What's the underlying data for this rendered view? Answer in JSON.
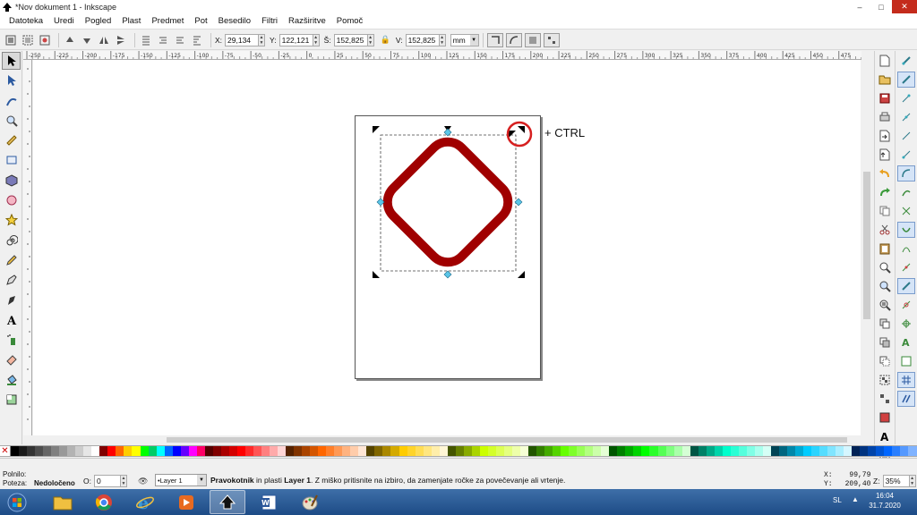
{
  "window": {
    "title": "*Nov dokument 1 - Inkscape",
    "minimize": "–",
    "maximize": "□",
    "close": "✕"
  },
  "menu": [
    "Datoteka",
    "Uredi",
    "Pogled",
    "Plast",
    "Predmet",
    "Pot",
    "Besedilo",
    "Filtri",
    "Razširitve",
    "Pomoč"
  ],
  "toolbar": {
    "x_label": "X:",
    "x_value": "29,134",
    "y_label": "Y:",
    "y_value": "122,121",
    "w_label": "Š:",
    "w_value": "152,825",
    "h_label": "V:",
    "h_value": "152,825",
    "unit": "mm"
  },
  "ruler": {
    "top_ticks": [
      "-250",
      "-225",
      "-200",
      "-175",
      "-150",
      "-125",
      "-100",
      "-75",
      "-50",
      "-25",
      "0",
      "25",
      "50",
      "75",
      "100",
      "125",
      "150",
      "175",
      "200",
      "225",
      "250",
      "275",
      "300",
      "325",
      "350",
      "375",
      "400",
      "425",
      "450",
      "475"
    ]
  },
  "canvas": {
    "annotation": "+ CTRL",
    "shape_color": "#a00000",
    "highlight_circle_color": "#d62020"
  },
  "palette": [
    "#000000",
    "#1a1a1a",
    "#333333",
    "#4d4d4d",
    "#666666",
    "#808080",
    "#999999",
    "#b3b3b3",
    "#cccccc",
    "#e6e6e6",
    "#ffffff",
    "#800000",
    "#ff0000",
    "#ff6600",
    "#ffcc00",
    "#ffff00",
    "#00ff00",
    "#00cc66",
    "#00ffff",
    "#0066ff",
    "#0000ff",
    "#6600ff",
    "#ff00ff",
    "#ff0066",
    "#550000",
    "#800000",
    "#aa0000",
    "#d40000",
    "#ff0000",
    "#ff2a2a",
    "#ff5555",
    "#ff8080",
    "#ffaaaa",
    "#ffd5d5",
    "#552200",
    "#803300",
    "#aa4400",
    "#d45500",
    "#ff6600",
    "#ff7f2a",
    "#ff9955",
    "#ffb380",
    "#ffccaa",
    "#ffe6d5",
    "#554400",
    "#806600",
    "#aa8800",
    "#d4aa00",
    "#ffcc00",
    "#ffd42a",
    "#ffdd55",
    "#ffe680",
    "#ffeeaa",
    "#fff6d5",
    "#445500",
    "#668000",
    "#88aa00",
    "#aad400",
    "#ccff00",
    "#d4ff2a",
    "#ddff55",
    "#e5ff80",
    "#eeffaa",
    "#f6ffd5",
    "#225500",
    "#338000",
    "#44aa00",
    "#55d400",
    "#66ff00",
    "#7fff2a",
    "#99ff55",
    "#b3ff80",
    "#ccffaa",
    "#e5ffd5",
    "#005500",
    "#008000",
    "#00aa00",
    "#00d400",
    "#00ff00",
    "#2aff2a",
    "#55ff55",
    "#80ff80",
    "#aaffaa",
    "#d5ffd5",
    "#005544",
    "#008066",
    "#00aa88",
    "#00d4aa",
    "#00ffcc",
    "#2affd5",
    "#55ffdd",
    "#80ffe6",
    "#aaffee",
    "#d5fff6",
    "#004455",
    "#006680",
    "#0088aa",
    "#00aad4",
    "#00ccff",
    "#2ad4ff",
    "#55ddff",
    "#80e5ff",
    "#aaeeff",
    "#d5f6ff",
    "#002255",
    "#003380",
    "#0044aa",
    "#0055d4",
    "#0066ff",
    "#2a7fff",
    "#5599ff",
    "#80b3ff"
  ],
  "status": {
    "fill_label": "Polnilo:",
    "stroke_label": "Poteza:",
    "stroke_value": "Nedoločeno",
    "opacity_label": "O:",
    "opacity_value": "0",
    "layer": "•Layer 1",
    "message_type": "Pravokotnik",
    "message_mid": " in plasti ",
    "message_layer": "Layer 1",
    "message_rest": ". Z miško pritisnite na izbiro, da zamenjate ročke za povečevanje ali vrtenje.",
    "x_label": "X:",
    "x_coord": "99,79",
    "y_label": "Y:",
    "y_coord": "209,40",
    "zoom_label": "Z:",
    "zoom_value": "35%"
  },
  "taskbar": {
    "language": "SL",
    "time": "16:04",
    "date": "31.7.2020"
  }
}
